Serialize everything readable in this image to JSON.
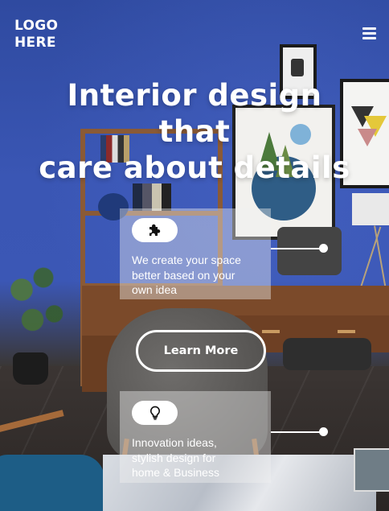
{
  "header": {
    "logo_line1": "LOGO",
    "logo_line2": "HERE",
    "menu_icon": "hamburger-menu-icon"
  },
  "hero": {
    "title_line1": "Interior design",
    "title_line2": "that",
    "title_line3": "care about details"
  },
  "features": [
    {
      "icon": "puzzle-piece-icon",
      "text_line1": "We create your space",
      "text_line2": "better based on your",
      "text_line3": "own idea"
    },
    {
      "icon": "lightbulb-icon",
      "text_line1": "Innovation ideas,",
      "text_line2": "stylish design for",
      "text_line3": "home & Business"
    }
  ],
  "cta": {
    "label": "Learn More"
  },
  "colors": {
    "wall_blue": "#3a56b4",
    "text": "#ffffff",
    "card_overlay": "rgba(240,240,240,0.42)"
  }
}
